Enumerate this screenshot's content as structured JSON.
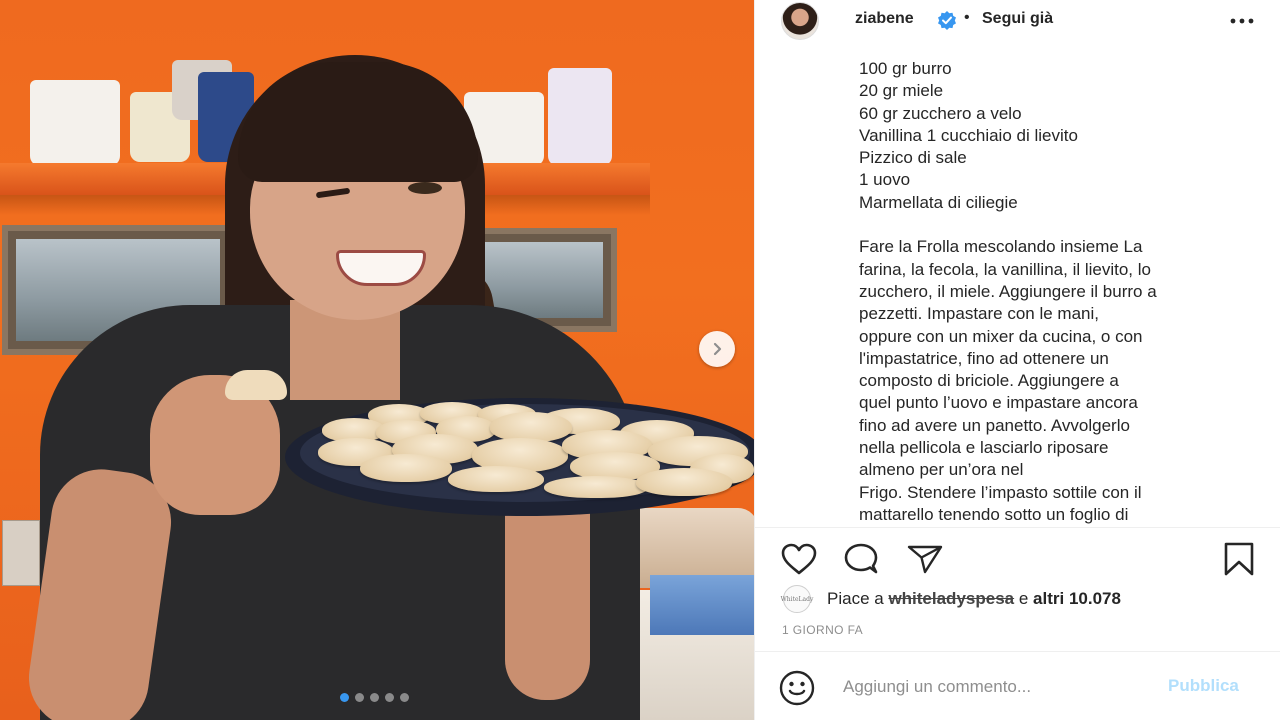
{
  "post": {
    "username": "ziabene",
    "separator": "•",
    "follow_status": "Segui già",
    "caption_lines": [
      "100 gr burro",
      "20 gr miele",
      "60 gr zucchero a velo",
      "Vanillina 1 cucchiaio di lievito",
      "Pizzico di sale",
      "1 uovo",
      "Marmellata di ciliegie",
      "",
      "Fare la Frolla mescolando insieme La",
      "farina, la fecola, la vanillina, il lievito, lo",
      "zucchero, il miele. Aggiungere il burro a",
      "pezzetti. Impastare con le mani,",
      "oppure con un mixer da cucina, o con",
      "l'impastatrice, fino ad ottenere un",
      "composto di briciole. Aggiungere a",
      "quel punto l’uovo e impastare ancora",
      "fino ad avere un panetto. Avvolgerlo",
      "nella pellicola e lasciarlo riposare",
      "almeno per un’ora nel",
      "Frigo. Stendere l’impasto sottile con il",
      "mattarello tenendo sotto un foglio di"
    ],
    "likes": {
      "prefix": "Piace a",
      "liker": "whiteladyspesa",
      "conjunction": "e",
      "others": "altri 10.078",
      "liker_avatar_text": "WhiteLady"
    },
    "timestamp": "1 GIORNO FA",
    "comment": {
      "placeholder": "Aggiungi un commento...",
      "publish_label": "Pubblica"
    },
    "carousel": {
      "slides": 5,
      "active": 1
    }
  },
  "icons": {
    "verified": "verified-badge-icon",
    "more": "more-options-icon",
    "like": "heart-icon",
    "comment": "comment-icon",
    "share": "paper-plane-icon",
    "save": "bookmark-icon",
    "emoji": "smiley-icon",
    "next": "chevron-right-icon"
  },
  "colors": {
    "verified_blue": "#3897f0",
    "publish_disabled": "#b2dffc",
    "muted_text": "#8e8e8e"
  }
}
